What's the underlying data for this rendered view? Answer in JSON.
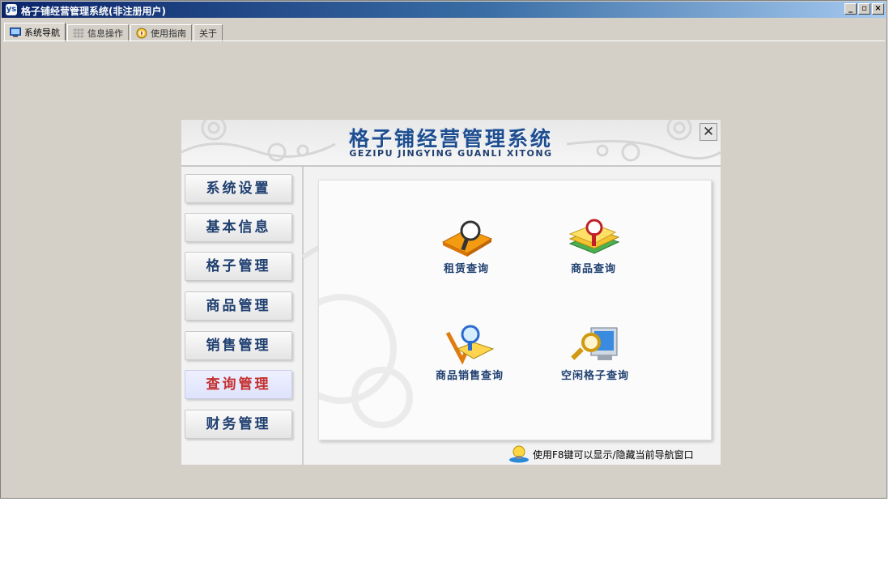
{
  "window": {
    "title": "格子铺经营管理系统(非注册用户)",
    "app_icon": "ys",
    "controls": [
      "_",
      "▫",
      "×"
    ]
  },
  "tabs": [
    {
      "label": "系统导航",
      "icon": "monitor-icon",
      "active": true
    },
    {
      "label": "信息操作",
      "icon": "grid-icon",
      "active": false
    },
    {
      "label": "使用指南",
      "icon": "compass-icon",
      "active": false
    },
    {
      "label": "关于",
      "icon": "",
      "active": false
    }
  ],
  "panel": {
    "banner_title": "格子铺经营管理系统",
    "banner_subtitle": "GEZIPU JINGYING GUANLI XITONG",
    "close_label": "✕",
    "menu": [
      {
        "label": "系统设置",
        "selected": false
      },
      {
        "label": "基本信息",
        "selected": false
      },
      {
        "label": "格子管理",
        "selected": false
      },
      {
        "label": "商品管理",
        "selected": false
      },
      {
        "label": "销售管理",
        "selected": false
      },
      {
        "label": "查询管理",
        "selected": true
      },
      {
        "label": "财务管理",
        "selected": false
      }
    ],
    "features": [
      {
        "label": "租赁查询",
        "icon": "folder-search-icon"
      },
      {
        "label": "商品查询",
        "icon": "books-search-icon"
      },
      {
        "label": "商品销售查询",
        "icon": "sales-search-icon"
      },
      {
        "label": "空闲格子查询",
        "icon": "monitor-search-icon"
      }
    ],
    "hint": "使用F8键可以显示/隐藏当前导航窗口"
  },
  "colors": {
    "title_bar": "#0a246a",
    "window_bg": "#d4d0c8",
    "accent_text": "#1f3f70",
    "selected_text": "#c43030"
  }
}
